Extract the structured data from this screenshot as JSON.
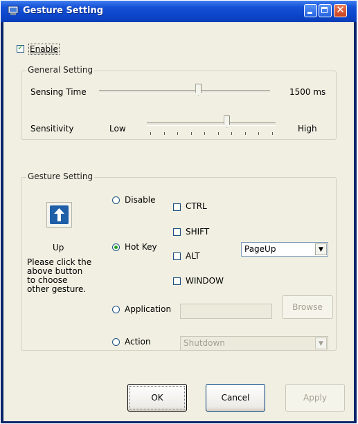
{
  "window": {
    "title": "Gesture Setting"
  },
  "enable": {
    "label": "Enable",
    "checked": true
  },
  "general_setting": {
    "title": "General Setting",
    "sensing_time": {
      "label": "Sensing Time",
      "value_text": "1500 ms",
      "level": 0.58
    },
    "sensitivity": {
      "label": "Sensitivity",
      "low_label": "Low",
      "high_label": "High",
      "level": 0.62,
      "ticks": 10
    }
  },
  "gesture_setting": {
    "title": "Gesture Setting",
    "gesture_button_icon": "arrow-up-icon",
    "gesture_name": "Up",
    "hint": "Please click the above button to choose other gesture.",
    "hint_lines": [
      "Please click the",
      "above button",
      "to choose",
      "other gesture."
    ],
    "options": {
      "disable": "Disable",
      "hotkey": "Hot Key",
      "application": "Application",
      "action": "Action"
    },
    "selected_option": "hotkey",
    "modifiers": {
      "ctrl": "CTRL",
      "shift": "SHIFT",
      "alt": "ALT",
      "window": "WINDOW"
    },
    "key_select": "PageUp",
    "application_path": "",
    "browse_label": "Browse",
    "action_select": "Shutdown"
  },
  "buttons": {
    "ok": "OK",
    "cancel": "Cancel",
    "apply": "Apply"
  },
  "colors": {
    "titlebar": "#0b45c9",
    "client_bg": "#f0efe2",
    "gesture_button": "#1f5fa8"
  }
}
